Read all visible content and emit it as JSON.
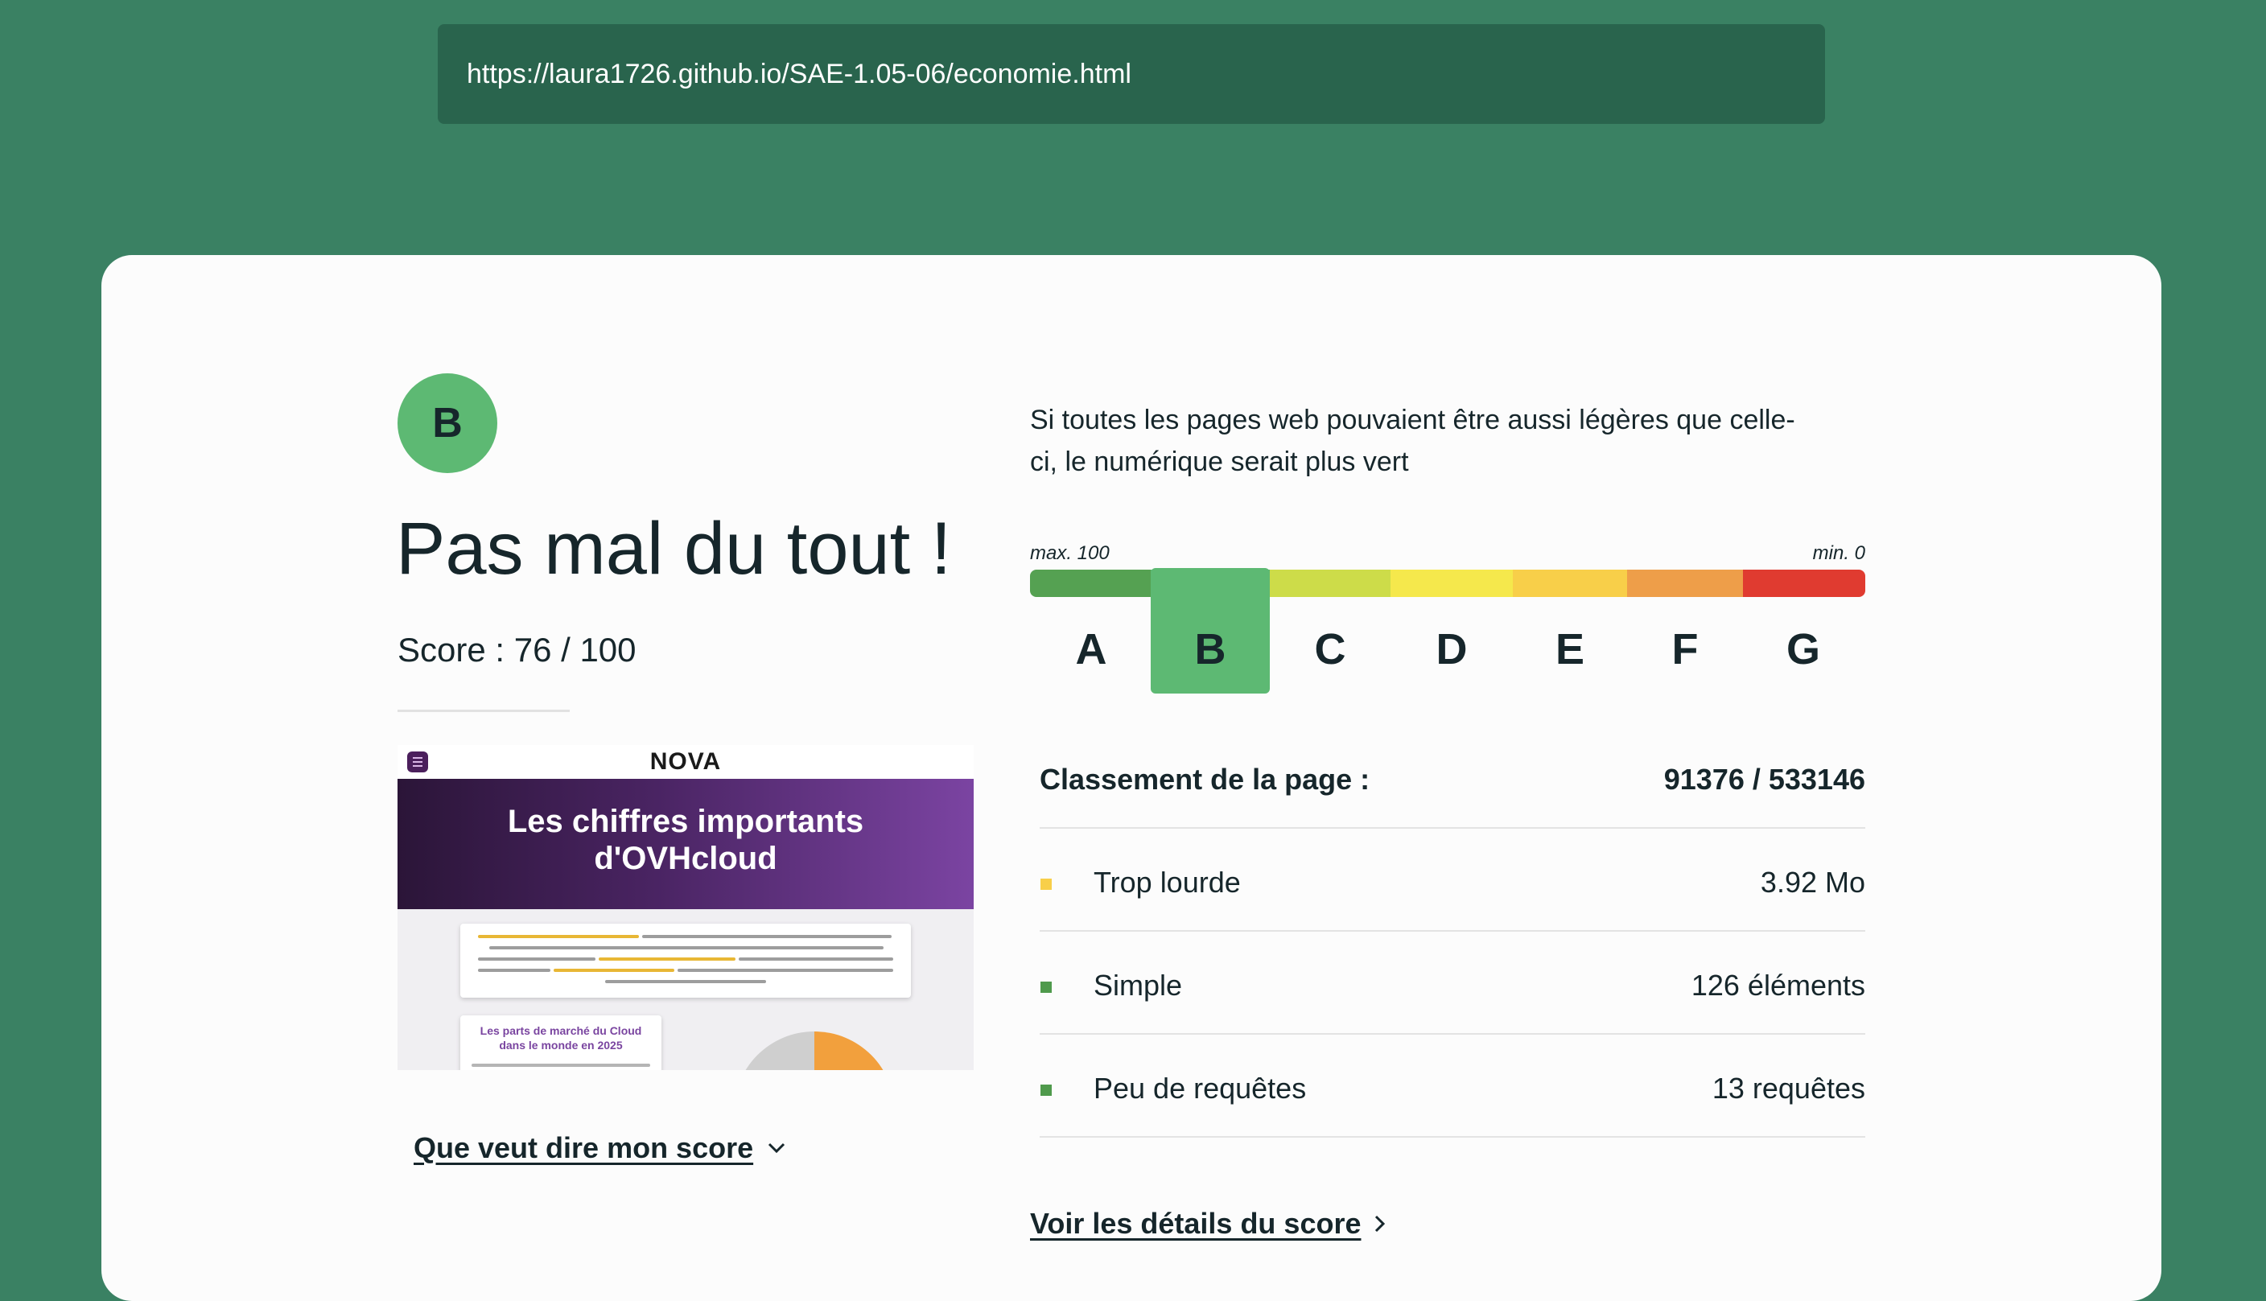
{
  "browser": {
    "url": "https://laura1726.github.io/SAE-1.05-06/economie.html"
  },
  "result": {
    "grade": "B",
    "headline": "Pas mal du tout !",
    "score_text": "Score : 76 / 100",
    "explain_link": "Que veut dire mon score"
  },
  "preview": {
    "logo": "NOVA",
    "banner_title_line1": "Les chiffres importants",
    "banner_title_line2": "d'OVHcloud",
    "card_title_line1": "Les parts de marché du Cloud",
    "card_title_line2": "dans le monde en 2025"
  },
  "scale": {
    "tagline": "Si toutes les pages web pouvaient être aussi légères que celle-ci, le numérique serait plus vert",
    "max_label": "max. 100",
    "min_label": "min. 0",
    "grades": [
      {
        "letter": "A",
        "color": "#55a152"
      },
      {
        "letter": "B",
        "color": "#5db973"
      },
      {
        "letter": "C",
        "color": "#cddc49"
      },
      {
        "letter": "D",
        "color": "#f5e84c"
      },
      {
        "letter": "E",
        "color": "#f8cf49"
      },
      {
        "letter": "F",
        "color": "#ee9e49"
      },
      {
        "letter": "G",
        "color": "#e03b30"
      }
    ],
    "selected": "B"
  },
  "ranking": {
    "label": "Classement de la page :",
    "value": "91376 / 533146"
  },
  "metrics": [
    {
      "label": "Trop lourde",
      "value": "3.92 Mo",
      "color": "#f8cf49"
    },
    {
      "label": "Simple",
      "value": "126 éléments",
      "color": "#4f9a4c"
    },
    {
      "label": "Peu de requêtes",
      "value": "13 requêtes",
      "color": "#4f9a4c"
    }
  ],
  "details_link": "Voir les détails du score"
}
